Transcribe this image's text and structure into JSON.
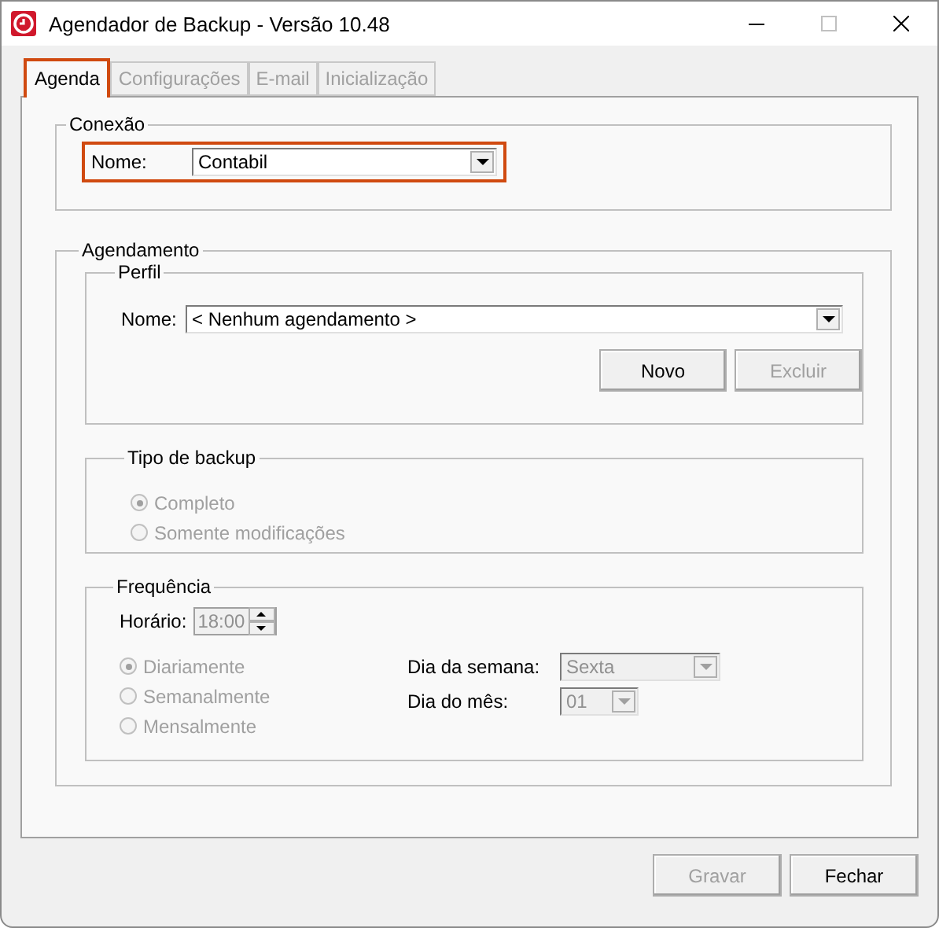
{
  "window": {
    "title": "Agendador de Backup - Versão 10.48"
  },
  "tabs": [
    {
      "label": "Agenda",
      "selected": true,
      "disabled": false,
      "highlighted": true
    },
    {
      "label": "Configurações",
      "selected": false,
      "disabled": true,
      "highlighted": false
    },
    {
      "label": "E-mail",
      "selected": false,
      "disabled": true,
      "highlighted": false
    },
    {
      "label": "Inicialização",
      "selected": false,
      "disabled": true,
      "highlighted": false
    }
  ],
  "connection": {
    "title": "Conexão",
    "highlighted": true,
    "name_label": "Nome:",
    "name_value": "Contabil"
  },
  "schedule": {
    "title": "Agendamento",
    "profile": {
      "title": "Perfil",
      "name_label": "Nome:",
      "name_value": "< Nenhum agendamento >",
      "buttons": [
        {
          "label": "Novo",
          "disabled": false
        },
        {
          "label": "Excluir",
          "disabled": true
        }
      ]
    },
    "backup_type": {
      "title": "Tipo de backup",
      "options": [
        {
          "label": "Completo",
          "selected": true,
          "disabled": true
        },
        {
          "label": "Somente modificações",
          "selected": false,
          "disabled": true
        }
      ]
    },
    "frequency": {
      "title": "Frequência",
      "time_label": "Horário:",
      "time_value": "18:00",
      "time_disabled": true,
      "options": [
        {
          "label": "Diariamente",
          "selected": true,
          "disabled": true
        },
        {
          "label": "Semanalmente",
          "selected": false,
          "disabled": true
        },
        {
          "label": "Mensalmente",
          "selected": false,
          "disabled": true
        }
      ],
      "weekday_label": "Dia da semana:",
      "weekday_value": "Sexta",
      "weekday_disabled": true,
      "month_day_label": "Dia do mês:",
      "month_day_value": "01",
      "month_day_disabled": true
    }
  },
  "buttons": [
    {
      "label": "Gravar",
      "disabled": true
    },
    {
      "label": "Fechar",
      "disabled": false
    }
  ]
}
